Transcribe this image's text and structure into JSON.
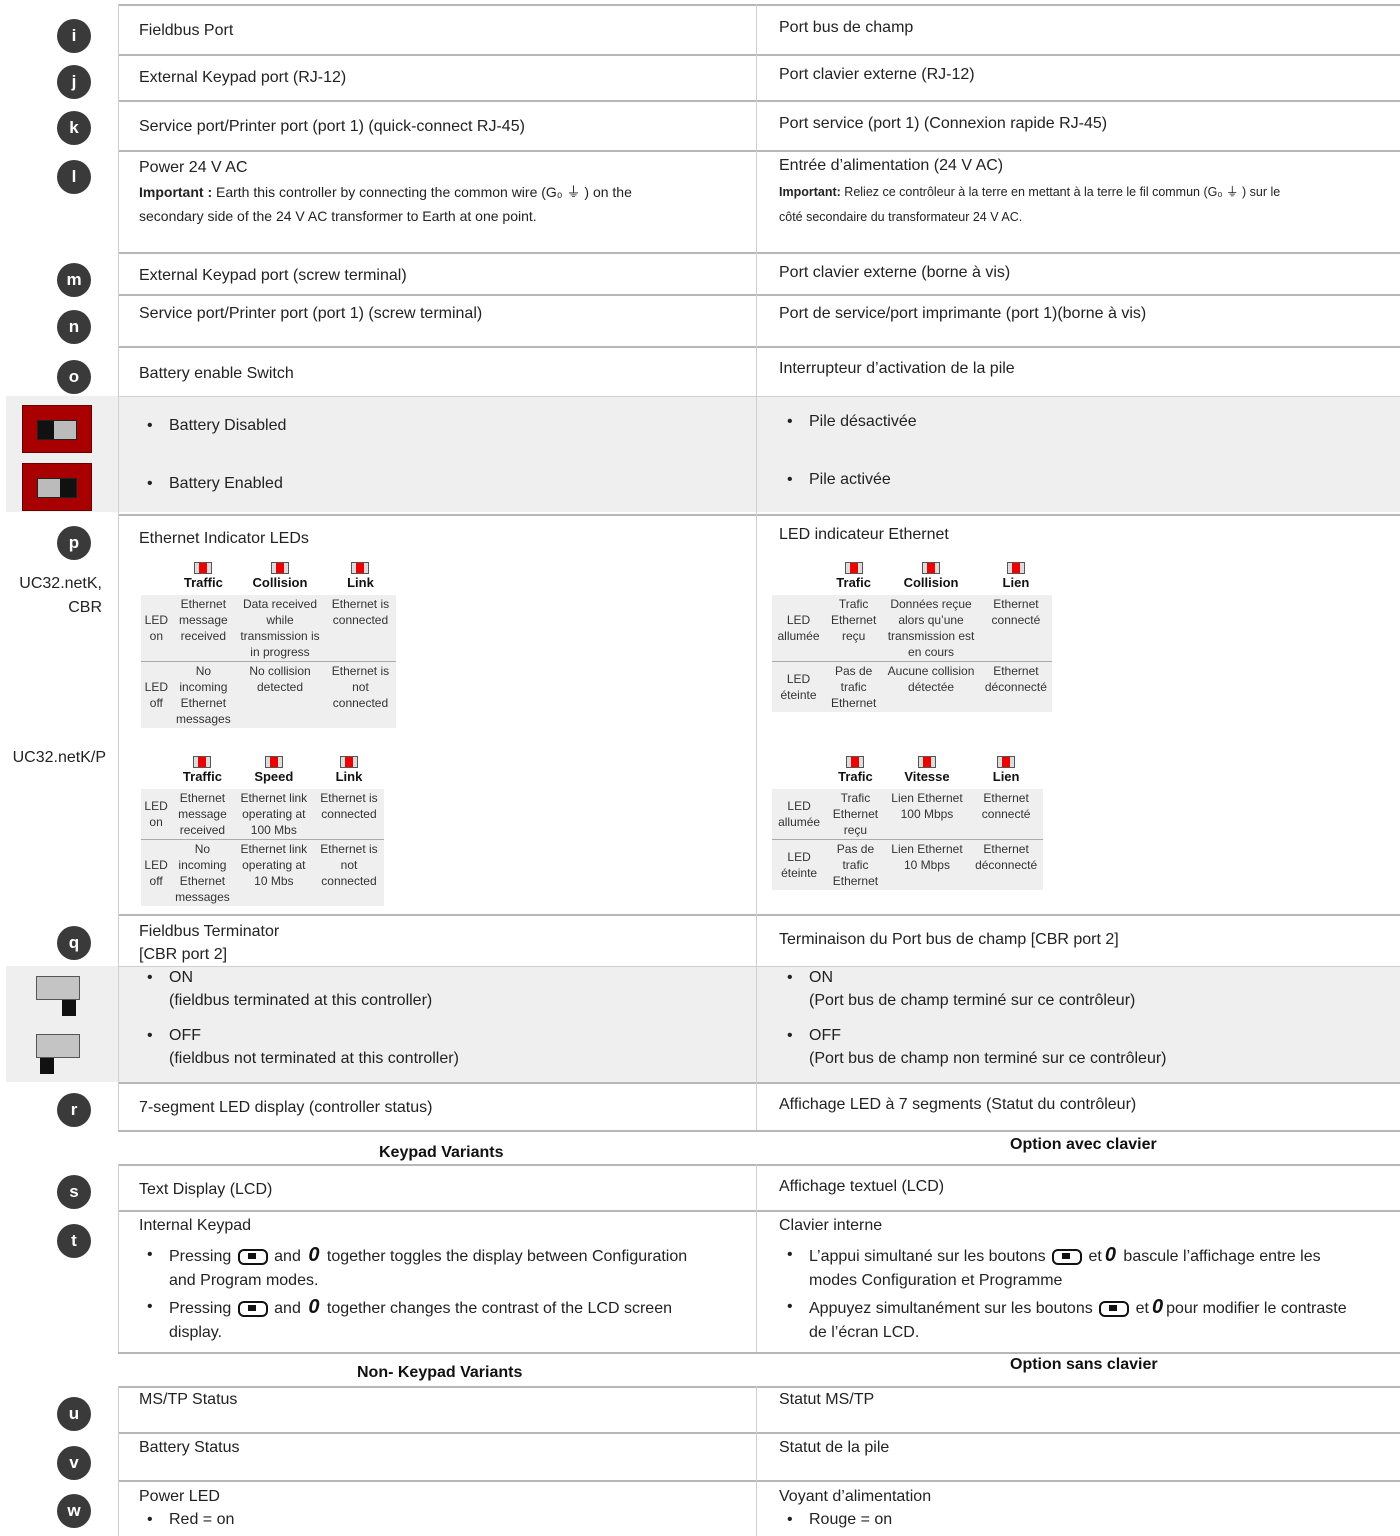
{
  "rows": {
    "i": {
      "letter": "i",
      "en": "Fieldbus Port",
      "fr": "Port bus de champ"
    },
    "j": {
      "letter": "j",
      "en": "External Keypad port (RJ-12)",
      "fr": "Port clavier externe (RJ-12)"
    },
    "k": {
      "letter": "k",
      "en": "Service port/Printer port (port 1) (quick-connect RJ-45)",
      "fr": "Port service (port 1) (Connexion rapide  RJ-45)"
    },
    "l": {
      "letter": "l",
      "en": "Power 24 V AC",
      "en_imp_label": "Important :",
      "en_imp_1": " Earth this controller by connecting the common wire (G₀ ⏚ ) on the",
      "en_imp_2": "secondary side of the 24 V AC transformer to Earth at one point.",
      "fr": "Entrée d’alimentation (24 V AC)",
      "fr_imp_label": "Important:",
      "fr_imp_1": " Reliez ce contrôleur à la terre en mettant à la terre le fil commun (G₀ ⏚ ) sur le",
      "fr_imp_2": "côté secondaire du transformateur 24 V AC."
    },
    "m": {
      "letter": "m",
      "en": "External Keypad port (screw terminal)",
      "fr": "Port clavier externe (borne à vis)"
    },
    "n": {
      "letter": "n",
      "en": "Service port/Printer port (port 1) (screw terminal)",
      "fr": "Port de service/port imprimante (port 1)(borne à vis)"
    },
    "o": {
      "letter": "o",
      "en": "Battery enable Switch",
      "fr": "Interrupteur d’activation de la pile"
    },
    "battery": {
      "en_disabled": "Battery Disabled",
      "en_enabled": "Battery Enabled",
      "fr_disabled": "Pile désactivée",
      "fr_enabled": "Pile activée"
    },
    "p": {
      "letter": "p",
      "en": "Ethernet Indicator LEDs",
      "fr": "LED indicateur Ethernet",
      "model1_a": "UC32.netK,",
      "model1_b": "CBR",
      "model2": "UC32.netK/P"
    },
    "q": {
      "letter": "q",
      "en_1": "Fieldbus Terminator",
      "en_2": "[CBR port 2]",
      "fr": "Terminaison du  Port bus de champ [CBR port 2]"
    },
    "term": {
      "on": "ON",
      "en_on_desc": "(fieldbus terminated at this controller)",
      "off": "OFF",
      "en_off_desc": "(fieldbus not terminated at this controller)",
      "fr_on_desc": "(Port bus de champ terminé sur ce contrôleur)",
      "fr_off_desc": "(Port bus de champ non terminé sur ce contrôleur)"
    },
    "r": {
      "letter": "r",
      "en": "7-segment LED display (controller status)",
      "fr": "Affichage LED à 7 segments (Statut du contrôleur)"
    },
    "s": {
      "letter": "s",
      "en": "Text Display (LCD)",
      "fr": "Affichage textuel (LCD)"
    },
    "t": {
      "letter": "t",
      "en": "Internal Keypad",
      "fr": "Clavier interne",
      "en_b1_a": "Pressing",
      "en_b1_b": "and",
      "en_b1_c": "together toggles the display between Configuration",
      "en_b1_d": "and Program modes.",
      "en_b2_a": "Pressing",
      "en_b2_b": "and",
      "en_b2_c": "together changes the contrast of the LCD screen",
      "en_b2_d": "display.",
      "fr_b1_a": "L’appui simultané sur les boutons",
      "fr_b1_b": "et",
      "fr_b1_c": "bascule l’affichage entre les",
      "fr_b1_d": "modes Configuration et Programme",
      "fr_b2_a": "Appuyez simultanément sur les boutons",
      "fr_b2_b": "et",
      "fr_b2_c": "pour modifier le contraste",
      "fr_b2_d": "de l’écran LCD."
    },
    "u": {
      "letter": "u",
      "en": "MS/TP Status",
      "fr": "Statut MS/TP"
    },
    "v": {
      "letter": "v",
      "en": "Battery Status",
      "fr": "Statut de la pile"
    },
    "w": {
      "letter": "w",
      "en": "Power LED",
      "fr": "Voyant d’alimentation",
      "en_b": "Red = on",
      "fr_b": "Rouge = on"
    }
  },
  "sections": {
    "keypad_en": "Keypad Variants",
    "keypad_fr": "Option avec clavier",
    "nokeypad_en": "Non- Keypad Variants",
    "nokeypad_fr": "Option sans clavier"
  },
  "led_tables": {
    "en1": {
      "h": [
        "Traffic",
        "Collision",
        "Link"
      ],
      "on": "LED on",
      "off": "LED off",
      "on_cells": [
        "Ethernet message received",
        "Data received while transmission is in progress",
        "Ethernet is connected"
      ],
      "off_cells": [
        "No incoming Ethernet messages",
        "No collision detected",
        "Ethernet is not connected"
      ]
    },
    "en2": {
      "h": [
        "Traffic",
        "Speed",
        "Link"
      ],
      "on": "LED on",
      "off": "LED off",
      "on_cells": [
        "Ethernet message received",
        "Ethernet link operating at 100 Mbs",
        "Ethernet is connected"
      ],
      "off_cells": [
        "No incoming Ethernet messages",
        "Ethernet link operating at 10 Mbs",
        "Ethernet is not connected"
      ]
    },
    "fr1": {
      "h": [
        "Trafic",
        "Collision",
        "Lien"
      ],
      "on": "LED allumée",
      "off": "LED éteinte",
      "on_cells": [
        "Trafic Ethernet reçu",
        "Données reçue alors qu’une transmission est en cours",
        "Ethernet connecté"
      ],
      "off_cells": [
        "Pas de trafic Ethernet",
        "Aucune collision détectée",
        "Ethernet déconnecté"
      ]
    },
    "fr2": {
      "h": [
        "Trafic",
        "Vitesse",
        "Lien"
      ],
      "on": "LED allumée",
      "off": "LED éteinte",
      "on_cells": [
        "Trafic Ethernet reçu",
        "Lien Ethernet 100 Mbps",
        "Ethernet connecté"
      ],
      "off_cells": [
        "Pas de trafic Ethernet",
        "Lien Ethernet 10 Mbps",
        "Ethernet déconnecté"
      ]
    }
  },
  "colors": {
    "led_red": "#e00000",
    "switch_red": "#a80000",
    "band": "#efefef",
    "rule": "#b7b7b7"
  }
}
